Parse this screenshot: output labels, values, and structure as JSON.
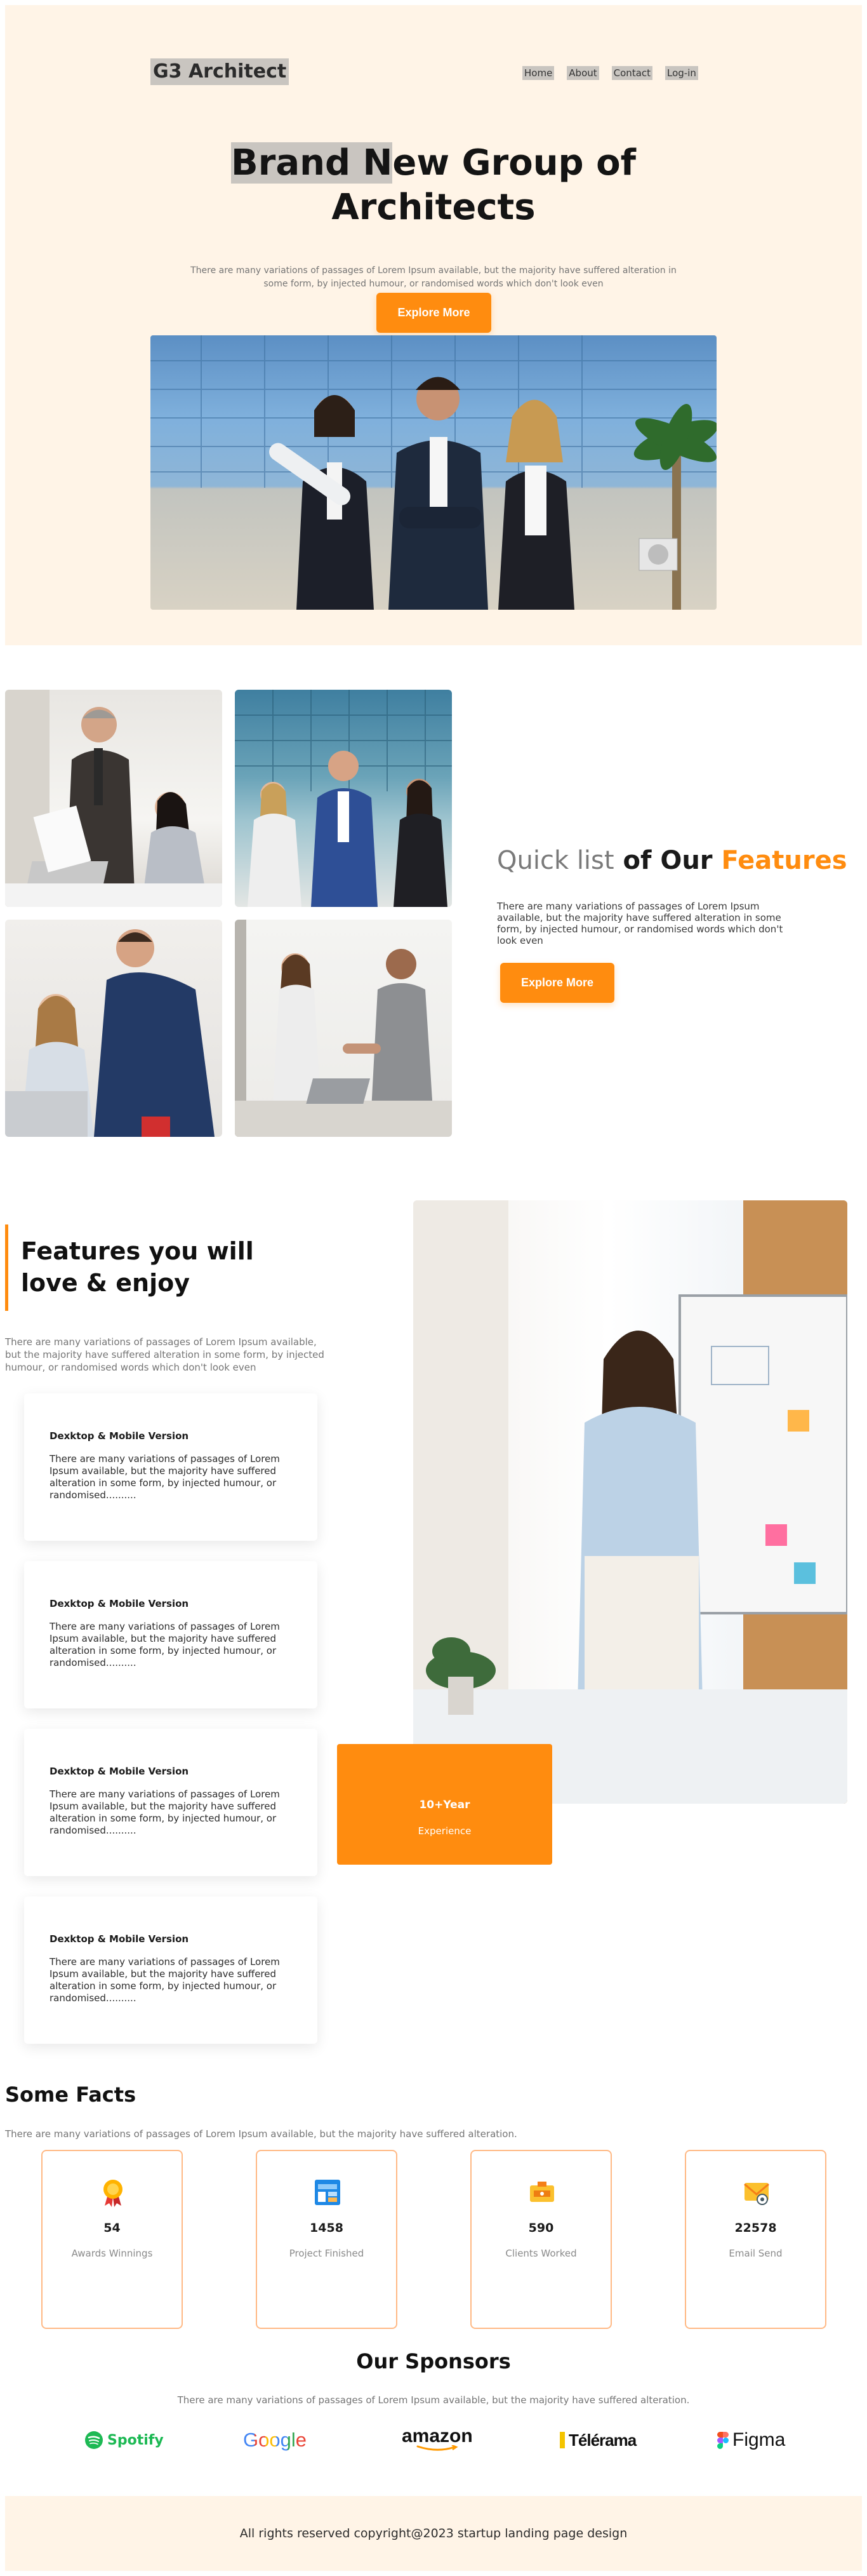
{
  "header": {
    "logo": "G3 Architect",
    "nav": [
      "Home",
      "About",
      "Contact",
      "Log-in"
    ]
  },
  "hero": {
    "title_highlight": "Brand N",
    "title_rest": "ew Group of",
    "title_line2": "Architects",
    "subtitle": "There are many variations of passages of Lorem Ipsum available, but the majority have suffered alteration in some form, by injected humour, or randomised words which don't look even",
    "button": "Explore More"
  },
  "quicklist": {
    "title_part1": "Quick list",
    "title_part2": "of Our",
    "title_part3": "Features",
    "text": "There are many variations of passages of Lorem Ipsum available, but the majority have suffered alteration in some form, by injected humour, or randomised words which don't look even",
    "button": "Explore More"
  },
  "features": {
    "title": "Features you will love & enjoy",
    "subtitle": "There are many variations of passages of Lorem Ipsum available, but the majority have suffered alteration in some form, by injected humour, or randomised words which don't look even",
    "cards": [
      {
        "title": "Dexktop & Mobile Version",
        "text": "There are many variations of passages of Lorem Ipsum available, but the majority have suffered alteration in some form, by injected humour, or randomised.........."
      },
      {
        "title": "Dexktop & Mobile Version",
        "text": "There are many variations of passages of Lorem Ipsum available, but the majority have suffered alteration in some form, by injected humour, or randomised.........."
      },
      {
        "title": "Dexktop & Mobile Version",
        "text": "There are many variations of passages of Lorem Ipsum available, but the majority have suffered alteration in some form, by injected humour, or randomised.........."
      },
      {
        "title": "Dexktop & Mobile Version",
        "text": "There are many variations of passages of Lorem Ipsum available, but the majority have suffered alteration in some form, by injected humour, or randomised.........."
      }
    ],
    "experience_years": "10+Year",
    "experience_label": "Experience"
  },
  "facts": {
    "title": "Some Facts",
    "subtitle": "There are many variations of passages of Lorem Ipsum available, but the majority have suffered alteration.",
    "items": [
      {
        "number": "54",
        "label": "Awards Winnings",
        "icon": "award-ribbon-icon"
      },
      {
        "number": "1458",
        "label": "Project Finished",
        "icon": "project-board-icon"
      },
      {
        "number": "590",
        "label": "Clients Worked",
        "icon": "clients-badge-icon"
      },
      {
        "number": "22578",
        "label": "Email Send",
        "icon": "email-envelope-icon"
      }
    ]
  },
  "sponsors": {
    "title": "Our Sponsors",
    "subtitle": "There are many variations of passages of Lorem Ipsum available, but the majority have suffered alteration.",
    "logos": [
      "Spotify",
      "Google",
      "amazon",
      "Télérama",
      "Figma"
    ]
  },
  "footer": {
    "text": "All rights reserved copyright@2023 startup landing page design"
  },
  "colors": {
    "accent": "#ff8c0f",
    "hero_bg": "#fff4e7"
  }
}
